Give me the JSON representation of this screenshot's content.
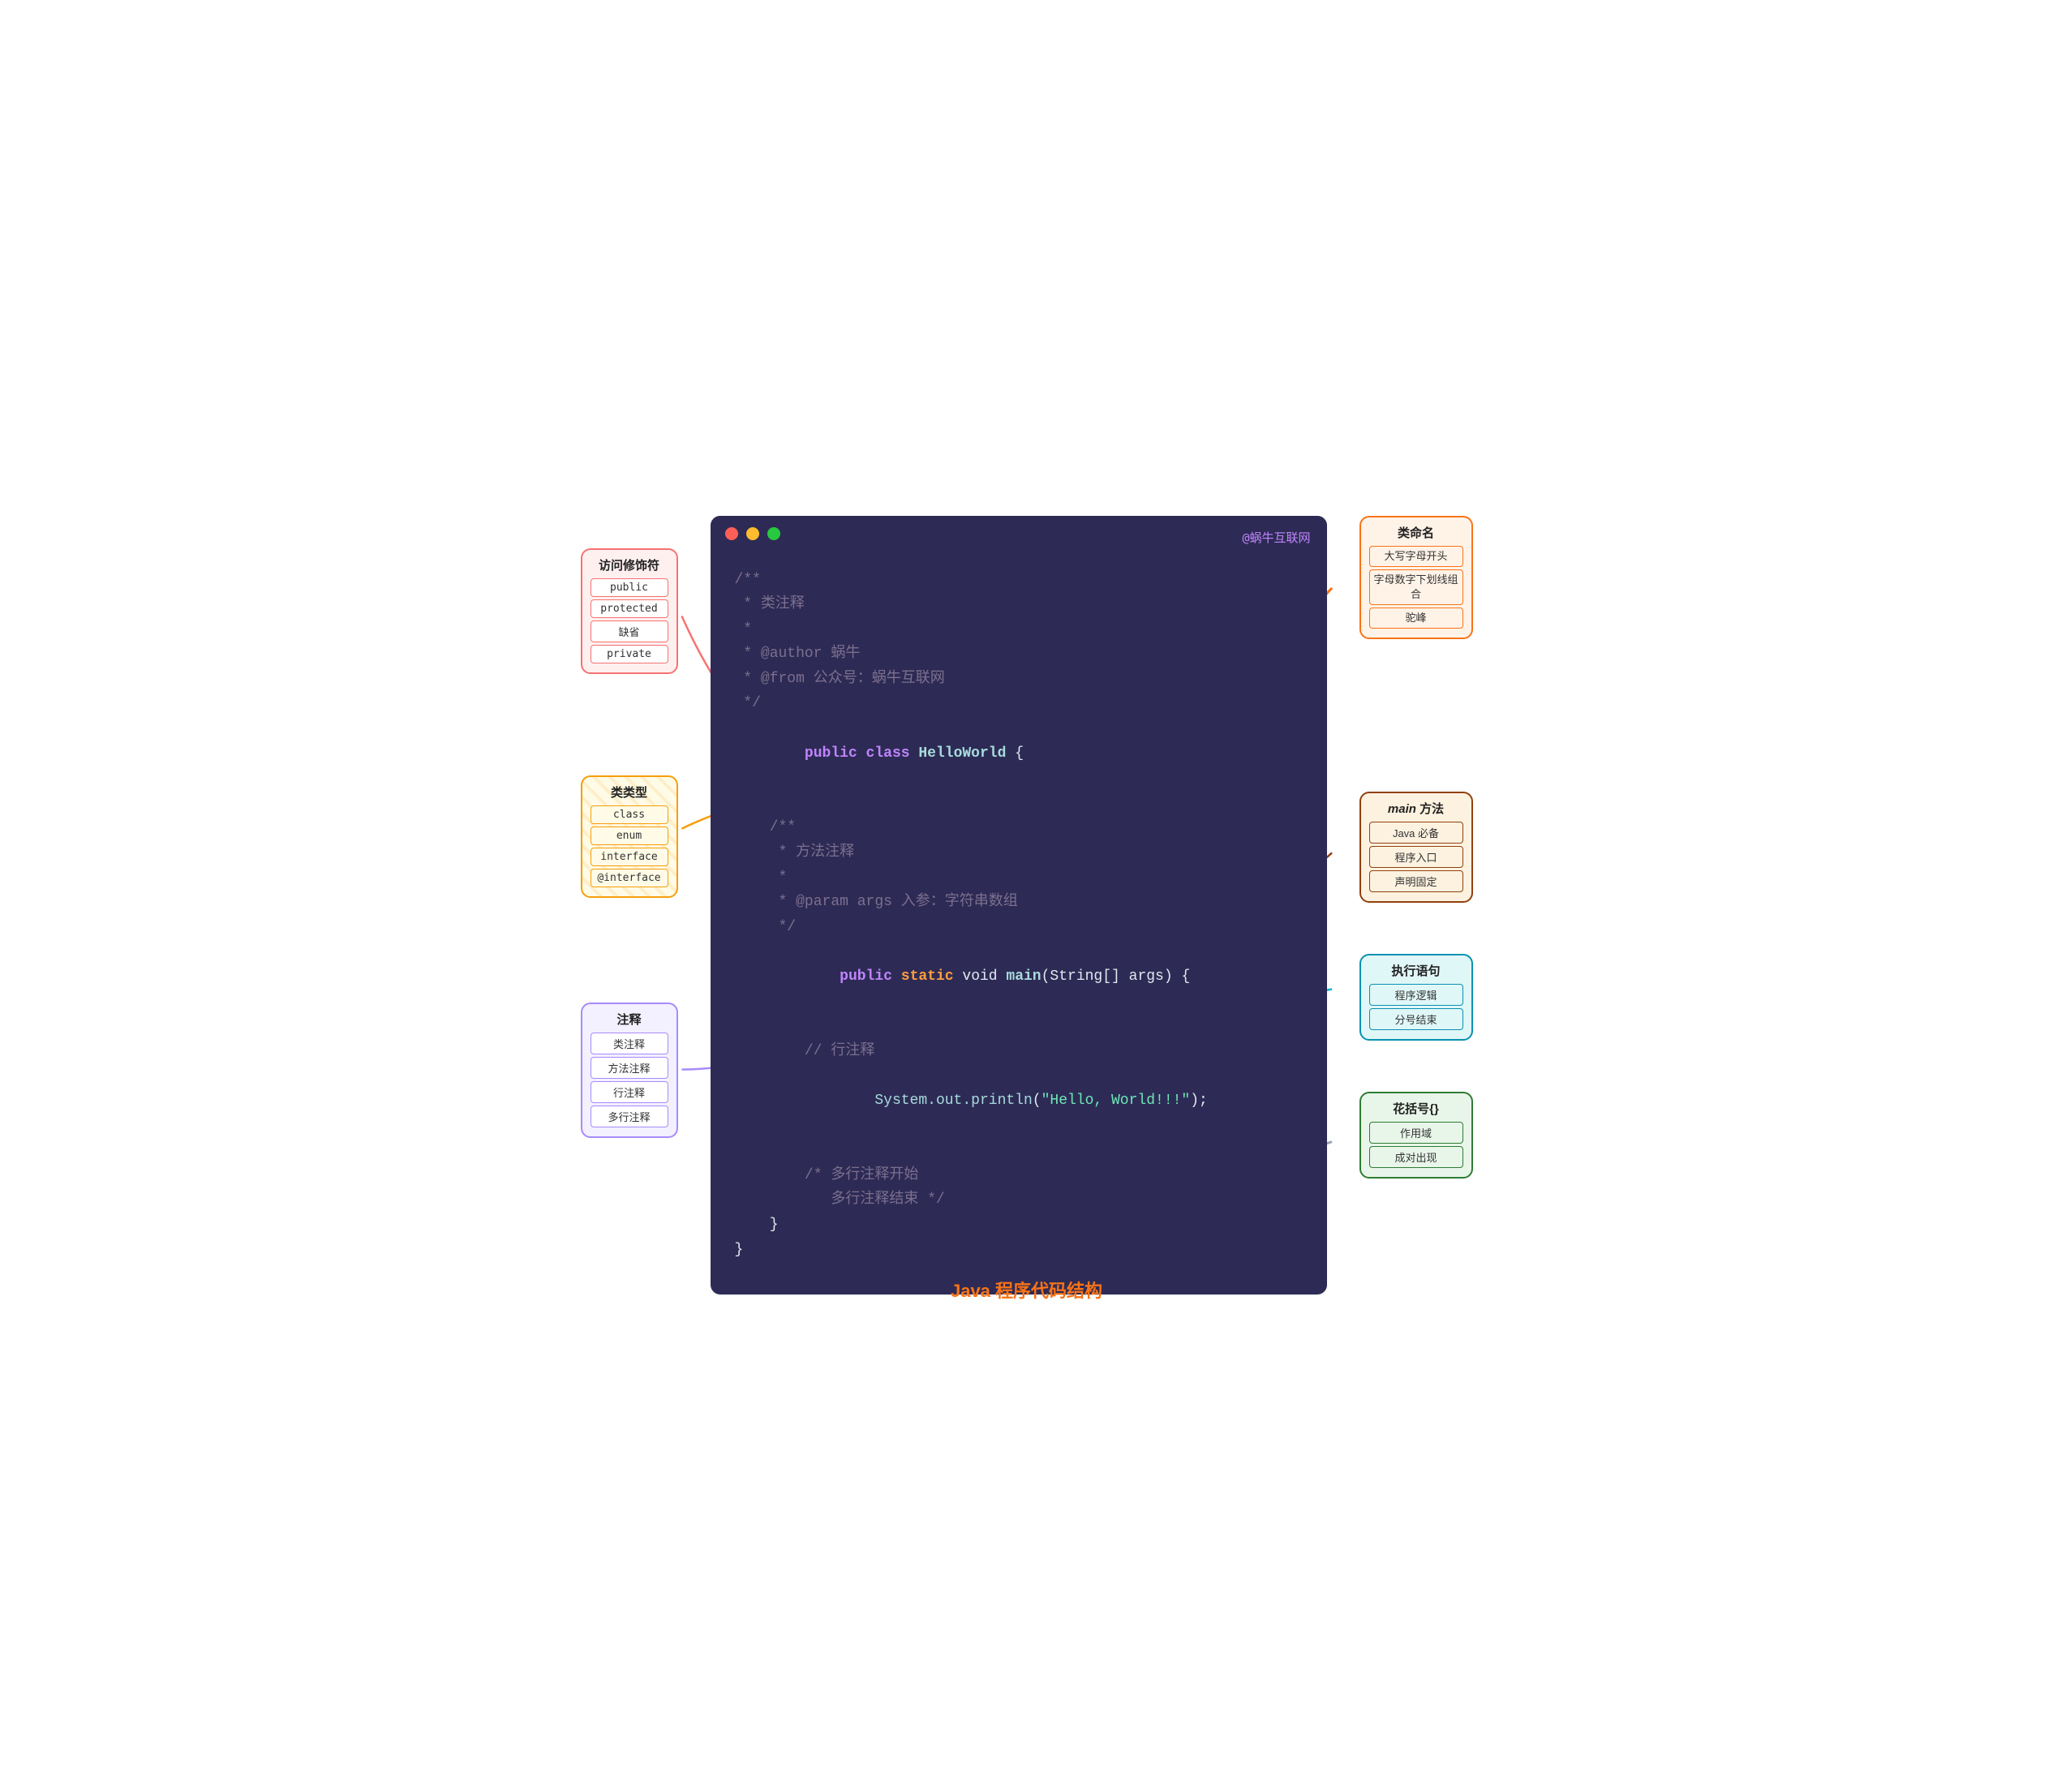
{
  "watermark": "@蜗牛互联网",
  "bottom_title": "Java 程序代码结构",
  "access_modifier": {
    "title": "访问修饰符",
    "items": [
      "public",
      "protected",
      "缺省",
      "private"
    ]
  },
  "class_type": {
    "title": "类类型",
    "items": [
      "class",
      "enum",
      "interface",
      "@interface"
    ]
  },
  "comment_box": {
    "title": "注释",
    "items": [
      "类注释",
      "方法注释",
      "行注释",
      "多行注释"
    ]
  },
  "class_name": {
    "title": "类命名",
    "items": [
      "大写字母开头",
      "字母数字下划线组合",
      "驼峰"
    ]
  },
  "main_method": {
    "title": "main 方法",
    "title_italic": "main",
    "items": [
      "Java 必备",
      "程序入口",
      "声明固定"
    ]
  },
  "exec_sentence": {
    "title": "执行语句",
    "items": [
      "程序逻辑",
      "分号结束"
    ]
  },
  "brace": {
    "title": "花括号{}",
    "items": [
      "作用域",
      "成对出现"
    ]
  },
  "code": {
    "comment1_line1": "/**",
    "comment1_line2": " * 类注释",
    "comment1_line3": " *",
    "comment1_line4": " * @author 蜗牛",
    "comment1_line5": " * @from 公众号：蜗牛互联网",
    "comment1_line6": " */",
    "class_decl": "public class HelloWorld {",
    "blank1": "",
    "comment2_line1": "    /**",
    "comment2_line2": "     * 方法注释",
    "comment2_line3": "     *",
    "comment2_line4": "     * @param args 入参：字符串数组",
    "comment2_line5": "     */",
    "method_decl": "    public static void main(String[] args) {",
    "blank2": "",
    "line_comment": "        // 行注释",
    "println": "        System.out.println(\"Hello, World!!!\");",
    "blank3": "",
    "multiline1": "        /* 多行注释开始",
    "multiline2": "           多行注释结束 */",
    "close_inner": "    }",
    "close_outer": "}"
  }
}
